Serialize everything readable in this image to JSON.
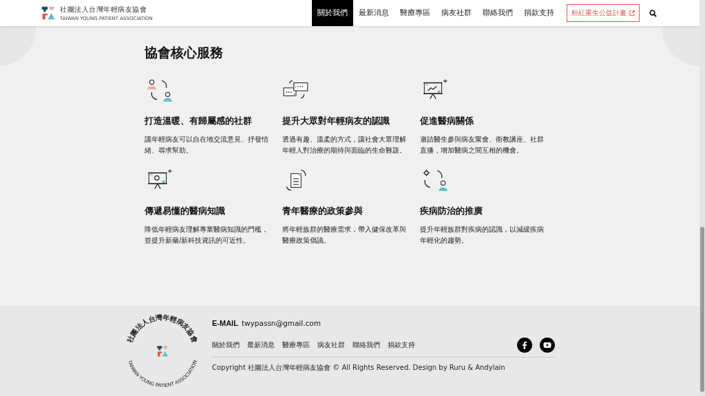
{
  "header": {
    "logo_zh": "社團法人台灣年輕病友協會",
    "logo_en": "TAIWAN YOUNG PATIENT ASSOCIATION",
    "nav": [
      {
        "label": "關於我們",
        "selected": true
      },
      {
        "label": "最新消息",
        "selected": false
      },
      {
        "label": "醫療專區",
        "selected": false
      },
      {
        "label": "病友社群",
        "selected": false
      },
      {
        "label": "聯絡我們",
        "selected": false
      },
      {
        "label": "捐款支持",
        "selected": false
      }
    ],
    "cta": "粉紅重生公益計畫"
  },
  "section": {
    "title": "協會核心服務",
    "services": [
      {
        "title": "打造溫暖、有歸屬感的社群",
        "text": "讓年輕病友可以自在地交流意見、抒發情緒、尋求幫助。"
      },
      {
        "title": "提升大眾對年輕病友的認識",
        "text": "透過有趣、溫柔的方式，讓社會大眾理解年輕人對治療的期待與面臨的生命難題。"
      },
      {
        "title": "促進醫病關係",
        "text": "邀請醫生參與病友聚會、衛教講座、社群直播，增加醫病之間互相的機會。"
      },
      {
        "title": "傳遞易懂的醫病知識",
        "text": "降低年輕病友理解專業醫病知識的門檻，並提升新藥/新科技資訊的可近性。"
      },
      {
        "title": "青年醫療的政策參與",
        "text": "將年輕族群的醫療需求，帶入健保改革與醫療政策倡議。"
      },
      {
        "title": "疾病防治的推廣",
        "text": "提升年輕族群對疾病的認識，以減緩疾病年輕化的趨勢。"
      }
    ]
  },
  "footer": {
    "seal_zh": "社團法人台灣年輕病友協會",
    "seal_en": "TAIWAN YOUNG PATIENT ASSOCIATION",
    "email_label": "E-MAIL",
    "email": "twypassn@gmail.com",
    "links": [
      "關於我們",
      "最新消息",
      "醫療專區",
      "病友社群",
      "聯絡我們",
      "捐款支持"
    ],
    "copyright": "Copyright 社團法人台灣年輕病友協會 © All Rights Reserved. Design by Ruru & Andylain"
  }
}
